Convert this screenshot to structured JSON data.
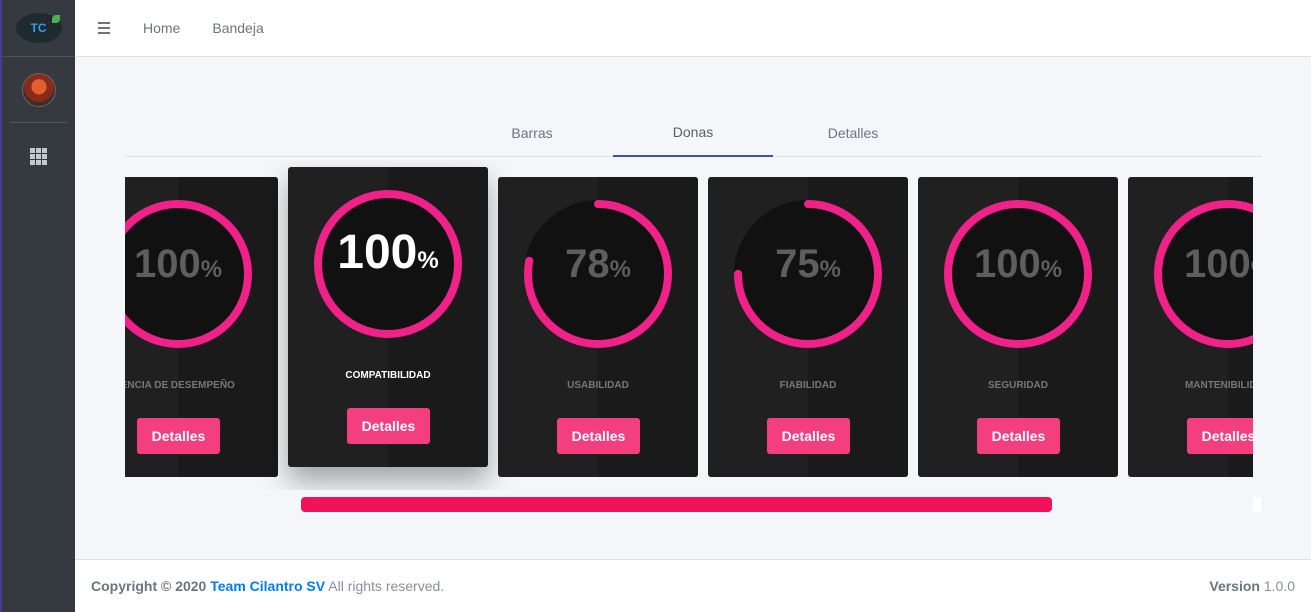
{
  "brand": {
    "logo_text": "TC"
  },
  "topbar": {
    "links": [
      "Home",
      "Bandeja"
    ]
  },
  "tabs": [
    {
      "label": "Barras",
      "active": false
    },
    {
      "label": "Donas",
      "active": true
    },
    {
      "label": "Detalles",
      "active": false
    }
  ],
  "cards": [
    {
      "percent": 100,
      "value_text": "100",
      "unit": "%",
      "label": "EFICIENCIA DE DESEMPEÑO",
      "button": "Detalles"
    },
    {
      "percent": 100,
      "value_text": "100",
      "unit": "%",
      "label": "COMPATIBILIDAD",
      "button": "Detalles",
      "raised": true
    },
    {
      "percent": 78,
      "value_text": "78",
      "unit": "%",
      "label": "USABILIDAD",
      "button": "Detalles"
    },
    {
      "percent": 75,
      "value_text": "75",
      "unit": "%",
      "label": "FIABILIDAD",
      "button": "Detalles"
    },
    {
      "percent": 100,
      "value_text": "100",
      "unit": "%",
      "label": "SEGURIDAD",
      "button": "Detalles"
    },
    {
      "percent": 100,
      "value_text": "100",
      "unit": "%",
      "label": "MANTENIBILIDAD",
      "button": "Detalles"
    }
  ],
  "colors": {
    "ring": "#f0228a",
    "button": "#f43f7f",
    "track": "#111111",
    "scrollbar": "#f0125a",
    "tab_active": "#3f51b5"
  },
  "footer": {
    "copyright": "Copyright © 2020",
    "team": "Team Cilantro SV",
    "rights": "All rights reserved.",
    "version_label": "Version",
    "version": "1.0.0"
  }
}
